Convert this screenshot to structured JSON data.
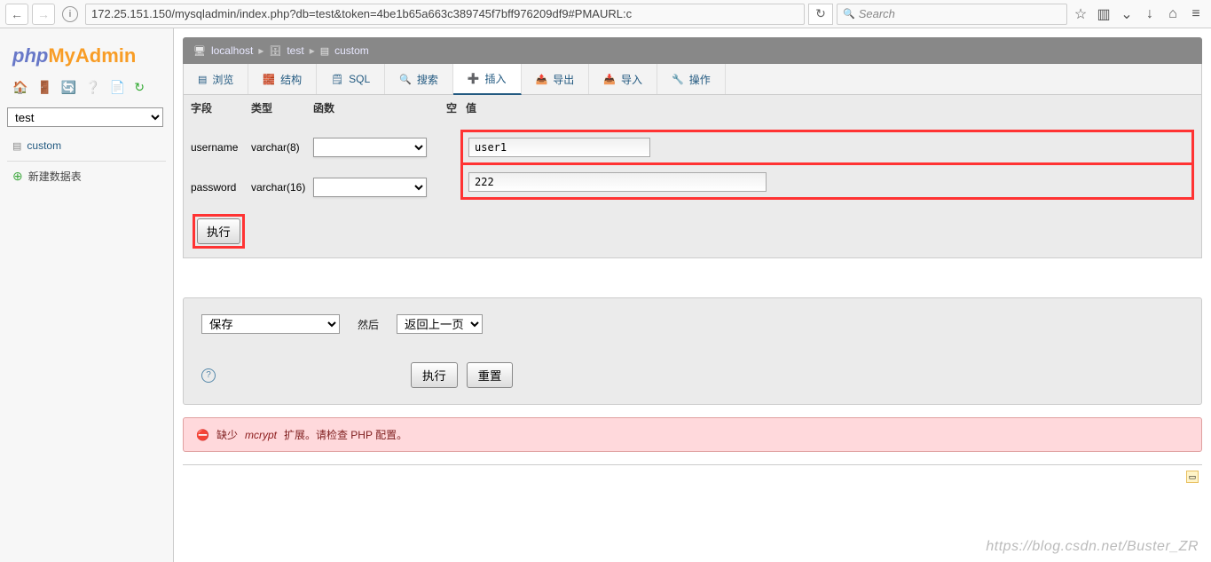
{
  "browser": {
    "url": "172.25.151.150/mysqladmin/index.php?db=test&token=4be1b65a663c389745f7bff976209df9#PMAURL:c",
    "search_placeholder": "Search"
  },
  "logo": {
    "php": "php",
    "my": "My",
    "admin": "Admin"
  },
  "sidebar": {
    "db_selected": "test",
    "table": "custom",
    "new_table_label": "新建数据表"
  },
  "breadcrumb": {
    "server": "localhost",
    "db": "test",
    "table": "custom"
  },
  "tabs": {
    "browse": "浏览",
    "structure": "结构",
    "sql": "SQL",
    "search": "搜索",
    "insert": "插入",
    "export": "导出",
    "import": "导入",
    "operations": "操作"
  },
  "headers": {
    "field": "字段",
    "type": "类型",
    "func": "函数",
    "null": "空",
    "value": "值"
  },
  "rows": [
    {
      "field": "username",
      "type": "varchar(8)",
      "value": "user1"
    },
    {
      "field": "password",
      "type": "varchar(16)",
      "value": "222"
    }
  ],
  "go_label": "执行",
  "bottom": {
    "save_option": "保存",
    "then_label": "然后",
    "after_option": "返回上一页",
    "go": "执行",
    "reset": "重置"
  },
  "warning": {
    "prefix": "缺少 ",
    "link": "mcrypt",
    "suffix": " 扩展。请检查 PHP 配置。"
  },
  "watermark": "https://blog.csdn.net/Buster_ZR"
}
